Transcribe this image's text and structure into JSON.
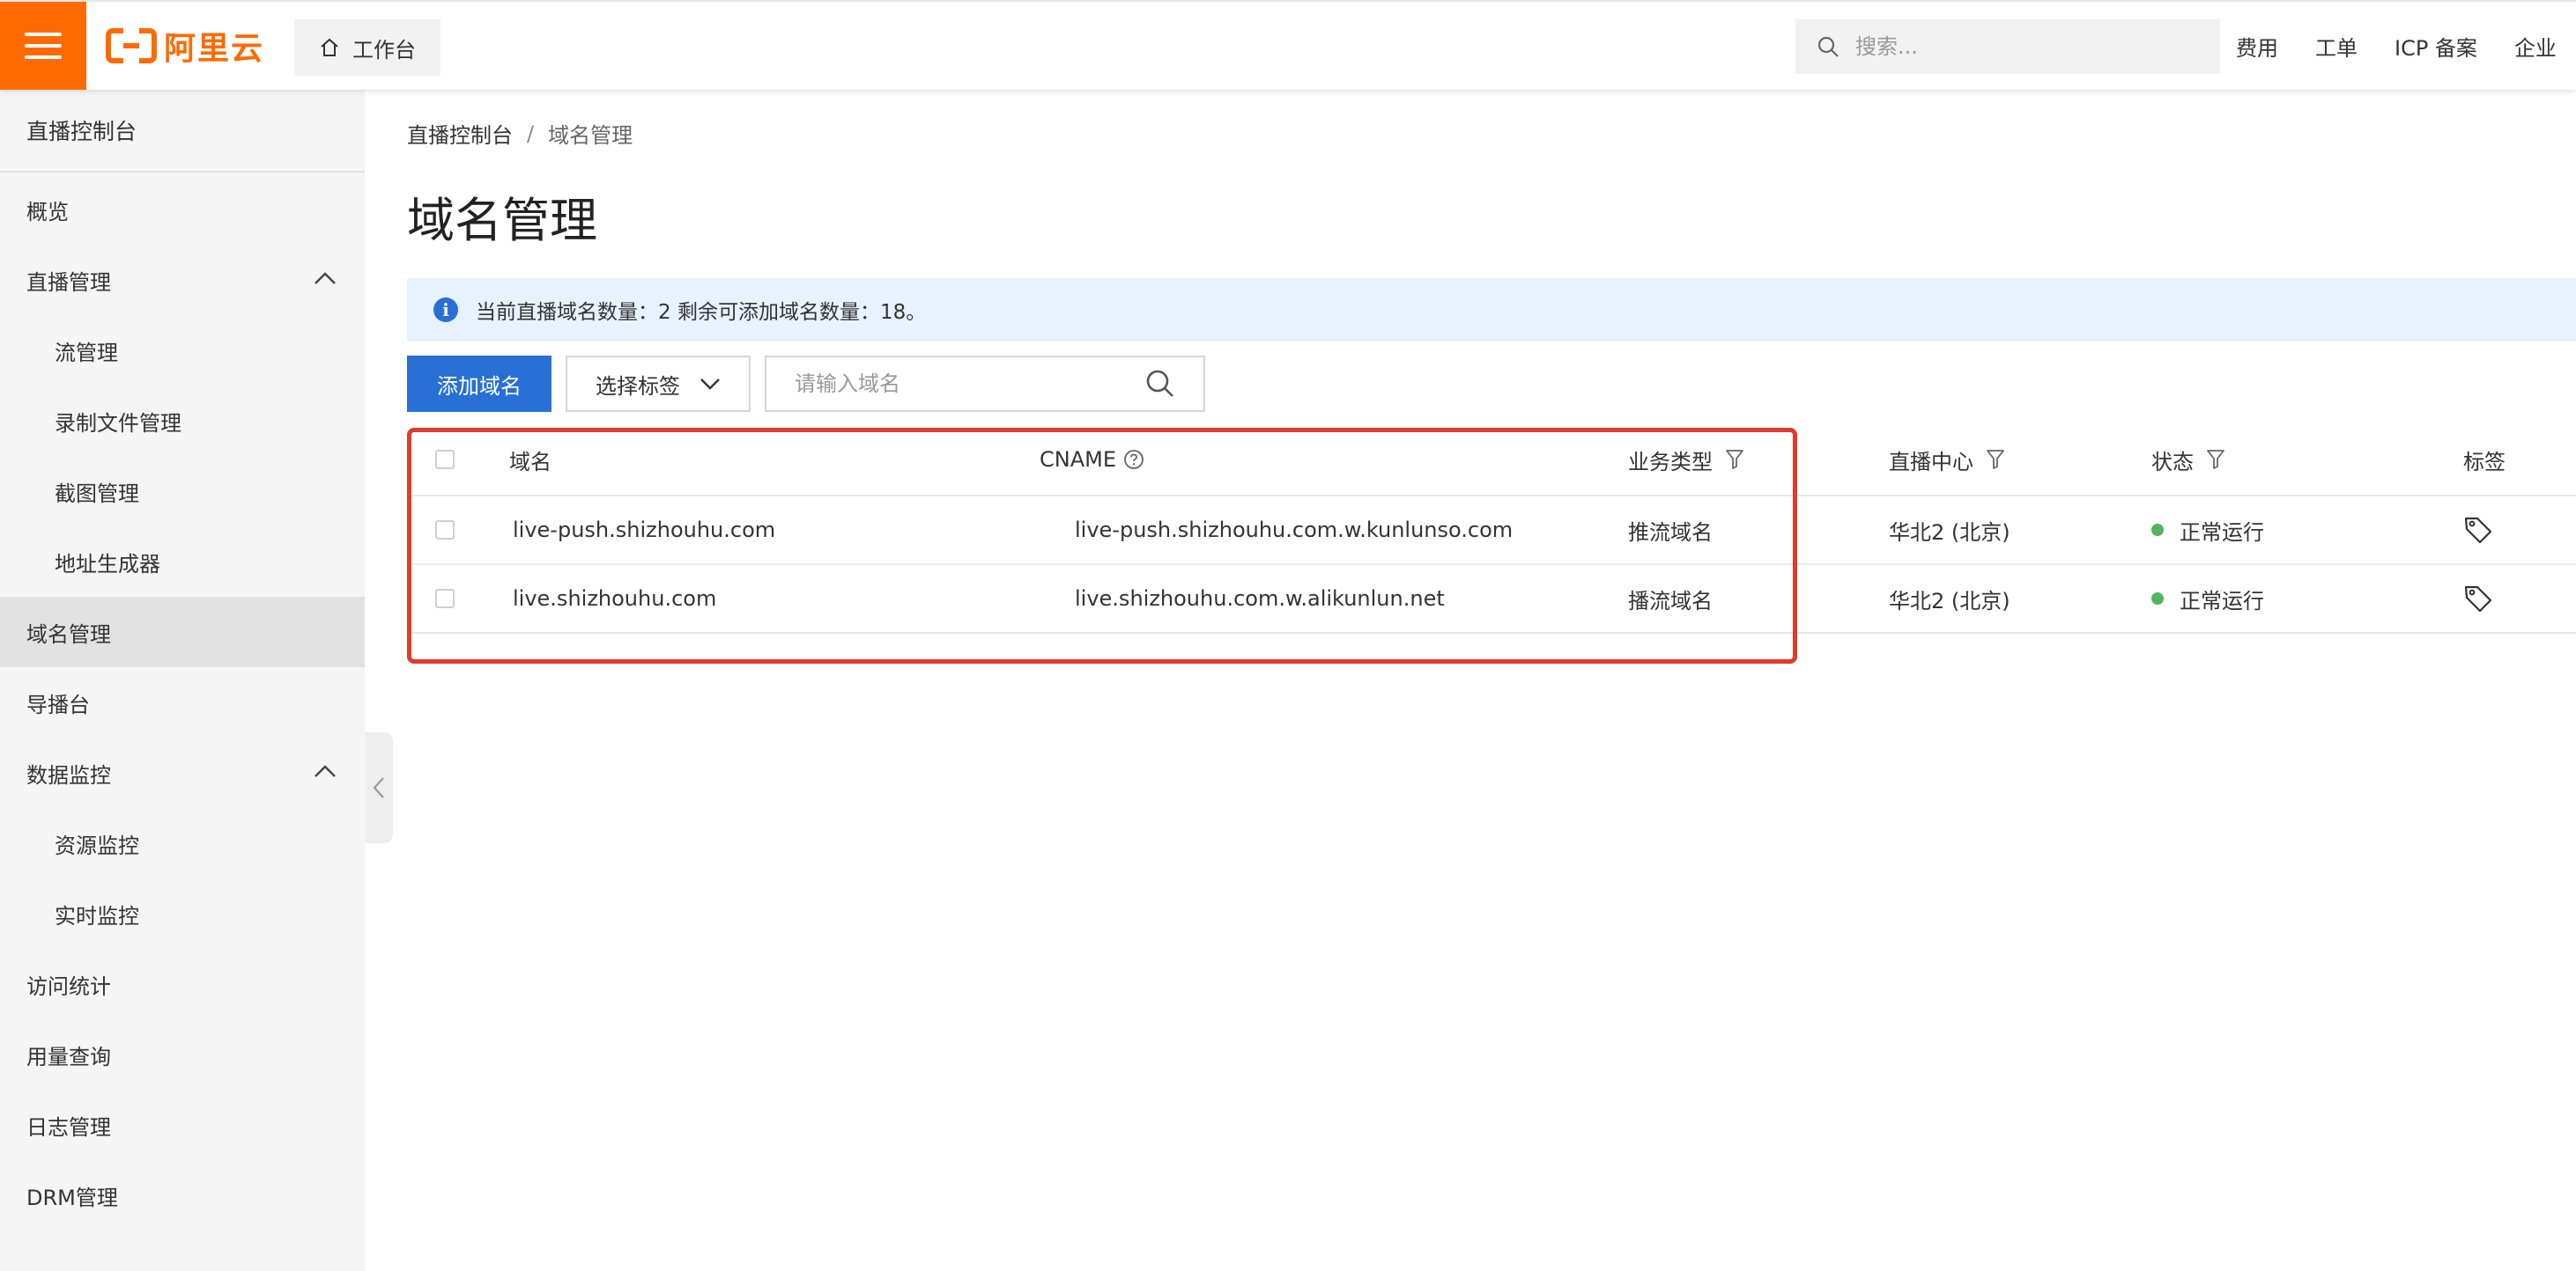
{
  "topbar": {
    "logo_text": "阿里云",
    "workbench_label": "工作台",
    "search_placeholder": "搜索...",
    "links": [
      "费用",
      "工单",
      "ICP 备案",
      "企业"
    ]
  },
  "sidebar": {
    "title": "直播控制台",
    "items": [
      {
        "label": "概览"
      },
      {
        "label": "直播管理"
      },
      {
        "label": "流管理"
      },
      {
        "label": "录制文件管理"
      },
      {
        "label": "截图管理"
      },
      {
        "label": "地址生成器"
      },
      {
        "label": "域名管理"
      },
      {
        "label": "导播台"
      },
      {
        "label": "数据监控"
      },
      {
        "label": "资源监控"
      },
      {
        "label": "实时监控"
      },
      {
        "label": "访问统计"
      },
      {
        "label": "用量查询"
      },
      {
        "label": "日志管理"
      },
      {
        "label": "DRM管理"
      }
    ]
  },
  "breadcrumb": {
    "root": "直播控制台",
    "separator": "/",
    "current": "域名管理"
  },
  "page": {
    "title": "域名管理",
    "notice": "当前直播域名数量：2 剩余可添加域名数量：18。"
  },
  "toolbar": {
    "add_label": "添加域名",
    "select_tag_label": "选择标签",
    "domain_search_placeholder": "请输入域名"
  },
  "table": {
    "columns": {
      "domain": "域名",
      "cname": "CNAME",
      "biz_type": "业务类型",
      "center": "直播中心",
      "status": "状态",
      "tags": "标签"
    },
    "rows": [
      {
        "domain": "live-push.shizhouhu.com",
        "cname": "live-push.shizhouhu.com.w.kunlunso.com",
        "biz_type": "推流域名",
        "center": "华北2 (北京)",
        "status": "正常运行"
      },
      {
        "domain": "live.shizhouhu.com",
        "cname": "live.shizhouhu.com.w.alikunlun.net",
        "biz_type": "播流域名",
        "center": "华北2 (北京)",
        "status": "正常运行"
      }
    ]
  },
  "colors": {
    "brand_orange": "#ff6a00",
    "primary_blue": "#2870d6",
    "status_green": "#52b45e",
    "highlight_red": "#e03b2c"
  },
  "icons": {
    "menu": "hamburger-icon",
    "home": "home-icon",
    "search": "search-icon",
    "chevron": "chevron-down-icon",
    "info": "info-icon",
    "filter": "filter-icon",
    "help": "question-circle-icon",
    "tag": "tag-icon"
  }
}
